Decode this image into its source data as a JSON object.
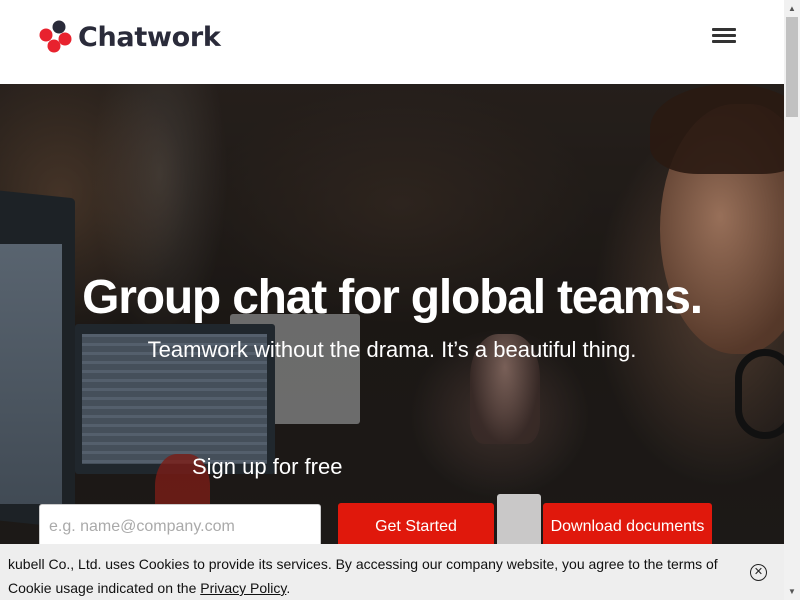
{
  "header": {
    "brand_name": "Chatwork",
    "menu_icon": "hamburger-menu-icon",
    "logo_colors": [
      "#e8222e",
      "#2a2b3a"
    ]
  },
  "hero": {
    "title": "Group chat for global teams.",
    "subtitle": "Teamwork without the drama. It’s a beautiful thing.",
    "signup_label": "Sign up for free",
    "email_placeholder": "e.g. name@company.com",
    "email_value": "",
    "get_started_label": "Get Started",
    "download_label": "Download documents",
    "button_color": "#e0180c"
  },
  "cookie_banner": {
    "text_before_link": "kubell Co., Ltd. uses Cookies to provide its services. By accessing our company website, you agree to the terms of Cookie usage indicated on the ",
    "link_text": "Privacy Policy",
    "text_after_link": ".",
    "close_icon": "close-circle-icon"
  },
  "scrollbar": {
    "up_icon": "arrow-up-icon",
    "down_icon": "arrow-down-icon"
  }
}
